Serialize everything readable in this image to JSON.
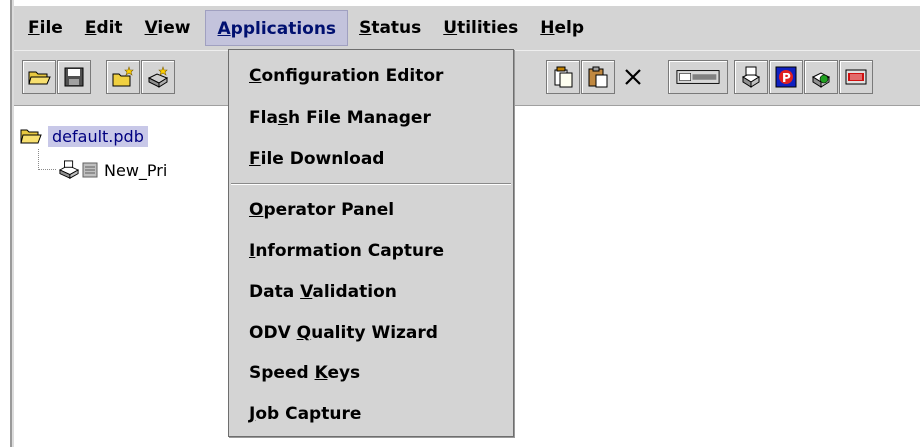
{
  "menubar": {
    "items": [
      {
        "label": "File",
        "mnemonic_index": 0
      },
      {
        "label": "Edit",
        "mnemonic_index": 0
      },
      {
        "label": "View",
        "mnemonic_index": 0
      },
      {
        "label": "Applications",
        "mnemonic_index": 0,
        "active": true
      },
      {
        "label": "Status",
        "mnemonic_index": 0
      },
      {
        "label": "Utilities",
        "mnemonic_index": 0
      },
      {
        "label": "Help",
        "mnemonic_index": 0
      }
    ]
  },
  "toolbar": {
    "icons": [
      "open-folder-icon",
      "save-disk-icon",
      "new-folder-icon",
      "new-printer-icon",
      "cut-icon",
      "copy-icon",
      "paste-icon",
      "delete-icon",
      "printer-panel-icon",
      "printer-settings-icon",
      "ppd-icon",
      "add-printer-icon",
      "media-icon"
    ]
  },
  "tree": {
    "root_label": "default.pdb",
    "child_label": "New_Pri"
  },
  "applications_menu": {
    "group1": [
      {
        "label": "Configuration Editor",
        "mnemonic_index": 0
      },
      {
        "label": "Flash File Manager",
        "mnemonic_index": 3
      },
      {
        "label": "File Download",
        "mnemonic_index": 0
      }
    ],
    "group2": [
      {
        "label": "Operator Panel",
        "mnemonic_index": 0
      },
      {
        "label": "Information Capture",
        "mnemonic_index": 0
      },
      {
        "label": "Data Validation",
        "mnemonic_index": 5
      },
      {
        "label": "ODV Quality Wizard",
        "mnemonic_index": 4
      },
      {
        "label": "Speed Keys",
        "mnemonic_index": 6
      },
      {
        "label": "Job Capture",
        "mnemonic_index": 0
      }
    ]
  },
  "colors": {
    "menubar_bg": "#d4d4d4",
    "active_menu_bg": "#c3c3dc",
    "selection_bg": "#c8c8e8"
  }
}
